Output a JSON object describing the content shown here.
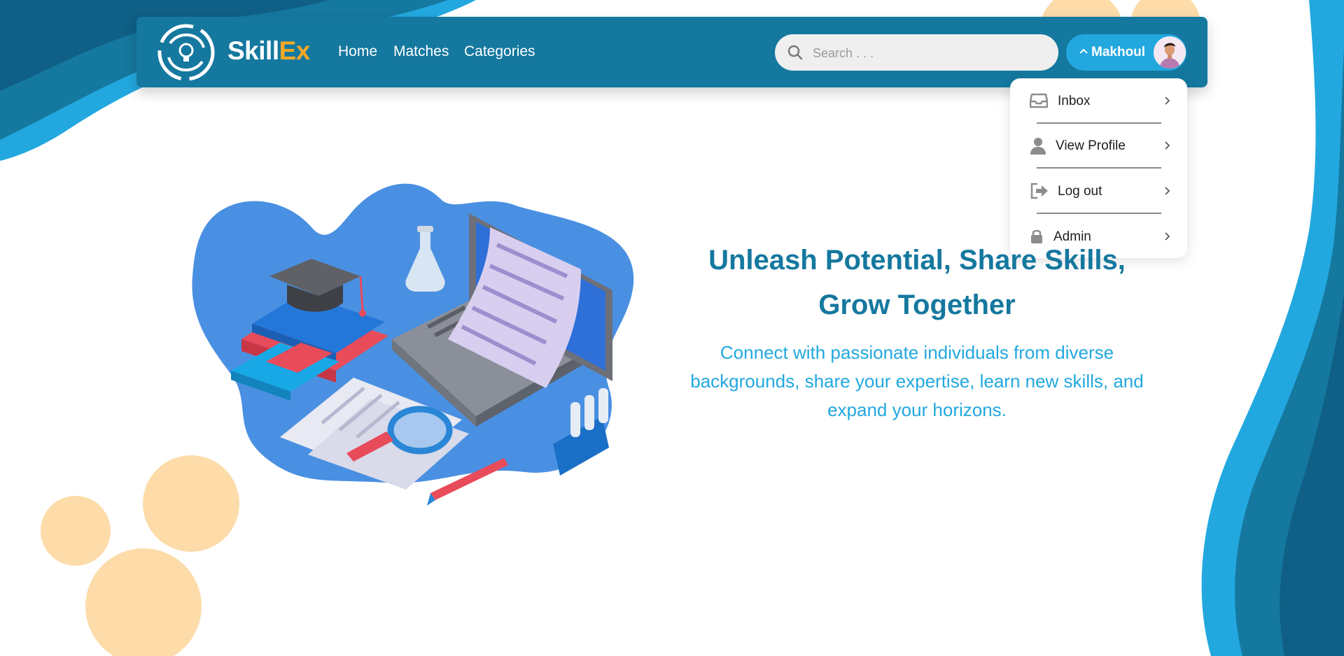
{
  "brand": {
    "name_main": "Skill",
    "name_accent": "Ex"
  },
  "nav": {
    "links": [
      "Home",
      "Matches",
      "Categories"
    ]
  },
  "search": {
    "placeholder": "Search . . ."
  },
  "user": {
    "name": "Makhoul"
  },
  "dropdown": {
    "items": [
      {
        "label": "Inbox",
        "icon": "inbox-icon"
      },
      {
        "label": "View Profile",
        "icon": "user-icon"
      },
      {
        "label": "Log out",
        "icon": "logout-icon"
      },
      {
        "label": "Admin",
        "icon": "lock-icon"
      }
    ]
  },
  "hero": {
    "title_line1": "Unleash Potential, Share Skills,",
    "title_line2": "Grow Together",
    "subtitle_line1": "Connect with passionate individuals from diverse",
    "subtitle_line2": "backgrounds, share your expertise, learn new skills, and",
    "subtitle_line3": "expand your horizons."
  },
  "colors": {
    "navbar": "#15789f",
    "accent": "#22a8df",
    "brand_accent": "#f7a823",
    "peach": "#fddcaa"
  }
}
